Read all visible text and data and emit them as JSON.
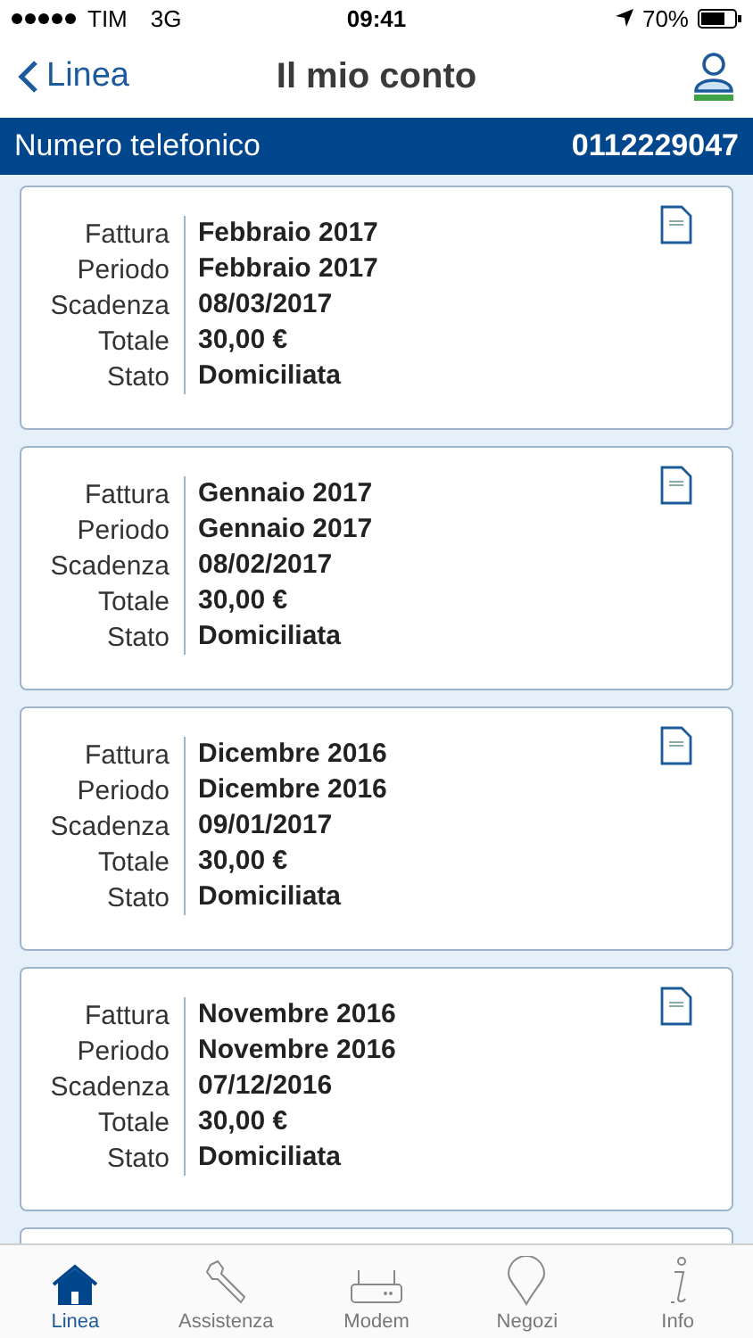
{
  "status_bar": {
    "carrier": "TIM",
    "network": "3G",
    "time": "09:41",
    "battery": "70%"
  },
  "nav": {
    "back": "Linea",
    "title": "Il mio conto"
  },
  "phone_band": {
    "label": "Numero telefonico",
    "number": "0112229047"
  },
  "invoices": [
    {
      "fields": [
        {
          "label": "Fattura",
          "value": "Febbraio 2017"
        },
        {
          "label": "Periodo",
          "value": "Febbraio 2017"
        },
        {
          "label": "Scadenza",
          "value": "08/03/2017"
        },
        {
          "label": "Totale",
          "value": "30,00 €"
        },
        {
          "label": "Stato",
          "value": "Domiciliata"
        }
      ]
    },
    {
      "fields": [
        {
          "label": "Fattura",
          "value": "Gennaio 2017"
        },
        {
          "label": "Periodo",
          "value": "Gennaio 2017"
        },
        {
          "label": "Scadenza",
          "value": "08/02/2017"
        },
        {
          "label": "Totale",
          "value": "30,00 €"
        },
        {
          "label": "Stato",
          "value": "Domiciliata"
        }
      ]
    },
    {
      "fields": [
        {
          "label": "Fattura",
          "value": "Dicembre 2016"
        },
        {
          "label": "Periodo",
          "value": "Dicembre 2016"
        },
        {
          "label": "Scadenza",
          "value": "09/01/2017"
        },
        {
          "label": "Totale",
          "value": "30,00 €"
        },
        {
          "label": "Stato",
          "value": "Domiciliata"
        }
      ]
    },
    {
      "fields": [
        {
          "label": "Fattura",
          "value": "Novembre 2016"
        },
        {
          "label": "Periodo",
          "value": "Novembre 2016"
        },
        {
          "label": "Scadenza",
          "value": "07/12/2016"
        },
        {
          "label": "Totale",
          "value": "30,00 €"
        },
        {
          "label": "Stato",
          "value": "Domiciliata"
        }
      ]
    }
  ],
  "tabs": [
    {
      "kind": "home",
      "label": "Linea",
      "selected": true
    },
    {
      "kind": "wrench",
      "label": "Assistenza",
      "selected": false
    },
    {
      "kind": "modem",
      "label": "Modem",
      "selected": false
    },
    {
      "kind": "pin",
      "label": "Negozi",
      "selected": false
    },
    {
      "kind": "info",
      "label": "Info",
      "selected": false
    }
  ]
}
